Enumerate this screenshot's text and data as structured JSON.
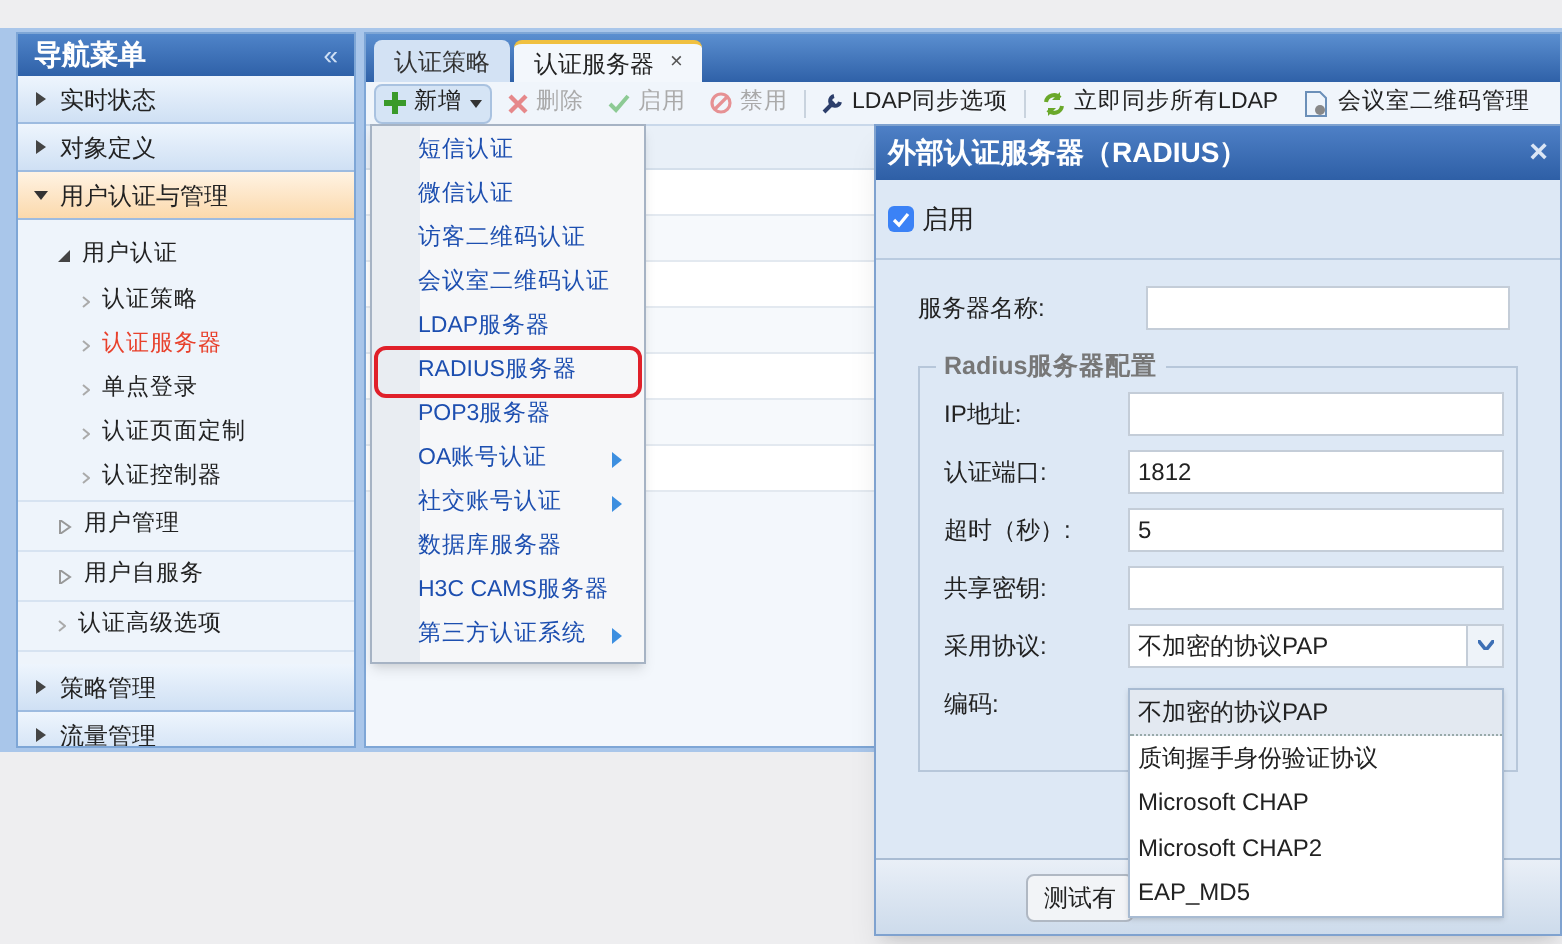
{
  "sidebar": {
    "title": "导航菜单",
    "collapse": "«",
    "sections": [
      {
        "label": "实时状态",
        "expanded": false
      },
      {
        "label": "对象定义",
        "expanded": false
      },
      {
        "label": "用户认证与管理",
        "expanded": true,
        "children": [
          {
            "label": "用户认证",
            "kind": "folder",
            "expanded": true,
            "children": [
              {
                "label": "认证策略",
                "selected": false
              },
              {
                "label": "认证服务器",
                "selected": true
              },
              {
                "label": "单点登录",
                "selected": false
              },
              {
                "label": "认证页面定制",
                "selected": false
              },
              {
                "label": "认证控制器",
                "selected": false
              }
            ]
          },
          {
            "label": "用户管理",
            "kind": "folder",
            "expanded": false
          },
          {
            "label": "用户自服务",
            "kind": "folder",
            "expanded": false
          },
          {
            "label": "认证高级选项",
            "kind": "link"
          }
        ]
      },
      {
        "label": "策略管理",
        "expanded": false
      },
      {
        "label": "流量管理",
        "expanded": false
      }
    ]
  },
  "tabs": [
    {
      "label": "认证策略",
      "selected": false
    },
    {
      "label": "认证服务器",
      "selected": true,
      "close": "×"
    }
  ],
  "toolbar": [
    {
      "label": "新增",
      "kind": "add",
      "disabled": false,
      "caret": true
    },
    {
      "label": "删除",
      "kind": "delete",
      "disabled": true
    },
    {
      "label": "启用",
      "kind": "enable",
      "disabled": true
    },
    {
      "label": "禁用",
      "kind": "disable",
      "disabled": true
    },
    {
      "label": "LDAP同步选项",
      "kind": "wrench",
      "disabled": false
    },
    {
      "label": "立即同步所有LDAP",
      "kind": "sync",
      "disabled": false
    },
    {
      "label": "会议室二维码管理",
      "kind": "doc",
      "disabled": false
    }
  ],
  "add_menu": [
    {
      "label": "短信认证",
      "submenu": false,
      "highlighted": false
    },
    {
      "label": "微信认证",
      "submenu": false,
      "highlighted": false
    },
    {
      "label": "访客二维码认证",
      "submenu": false,
      "highlighted": false
    },
    {
      "label": "会议室二维码认证",
      "submenu": false,
      "highlighted": false
    },
    {
      "label": "LDAP服务器",
      "submenu": false,
      "highlighted": false
    },
    {
      "label": "RADIUS服务器",
      "submenu": false,
      "highlighted": true
    },
    {
      "label": "POP3服务器",
      "submenu": false,
      "highlighted": false
    },
    {
      "label": "OA账号认证",
      "submenu": true,
      "highlighted": false
    },
    {
      "label": "社交账号认证",
      "submenu": true,
      "highlighted": false
    },
    {
      "label": "数据库服务器",
      "submenu": false,
      "highlighted": false
    },
    {
      "label": "H3C CAMS服务器",
      "submenu": false,
      "highlighted": false
    },
    {
      "label": "第三方认证系统",
      "submenu": true,
      "highlighted": false
    }
  ],
  "dialog": {
    "title": "外部认证服务器（RADIUS）",
    "close": "×",
    "enable": {
      "label": "启用",
      "checked": true
    },
    "server_name": {
      "label": "服务器名称:"
    },
    "fieldset": {
      "legend": "Radius服务器配置",
      "fields": [
        {
          "label": "IP地址:",
          "kind": "text"
        },
        {
          "label": "认证端口:",
          "kind": "text",
          "value": "1812"
        },
        {
          "label": "超时（秒）:",
          "kind": "text",
          "value": "5"
        },
        {
          "label": "共享密钥:",
          "kind": "text"
        },
        {
          "label": "采用协议:",
          "kind": "select",
          "value": "不加密的协议PAP"
        },
        {
          "label": "编码:",
          "kind": "none"
        }
      ]
    },
    "protocol_options": [
      {
        "label": "不加密的协议PAP",
        "selected": true
      },
      {
        "label": "质询握手身份验证协议",
        "selected": false
      },
      {
        "label": "Microsoft CHAP",
        "selected": false
      },
      {
        "label": "Microsoft CHAP2",
        "selected": false
      },
      {
        "label": "EAP_MD5",
        "selected": false
      }
    ],
    "test_button": "测试有"
  }
}
